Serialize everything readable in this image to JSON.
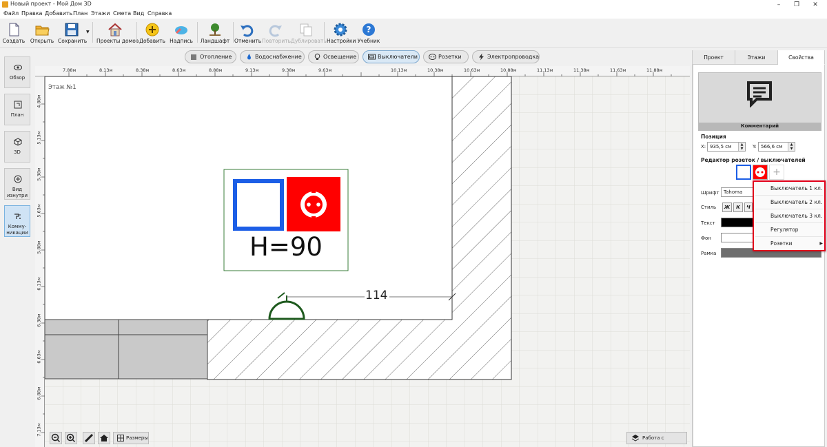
{
  "window": {
    "title": "Новый проект - Мой Дом 3D"
  },
  "menu": [
    "Файл",
    "Правка",
    "Добавить",
    "План",
    "Этажи",
    "Смета",
    "Вид",
    "Справка"
  ],
  "toolbar": {
    "create": "Создать",
    "open": "Открыть",
    "save": "Сохранить",
    "house_projects": "Проекты домов",
    "add": "Добавить",
    "caption": "Надпись",
    "landscape": "Ландшафт",
    "undo": "Отменить",
    "redo": "Повторить",
    "duplicate": "Дублировать",
    "settings": "Настройки",
    "tutorial": "Учебник"
  },
  "sidebar": {
    "overview": "Обзор",
    "plan": "План",
    "view3d": "3D",
    "inside_l1": "Вид",
    "inside_l2": "изнутри",
    "comm_l1": "Комму-",
    "comm_l2": "никации"
  },
  "categories": [
    "Отопление",
    "Водоснабжение",
    "Освещение",
    "Выключатели",
    "Розетки",
    "Электропроводка"
  ],
  "active_category": "Выключатели",
  "ruler": {
    "h": [
      "7.88м",
      "8.13м",
      "8.38м",
      "8.63м",
      "8.88м",
      "9.13м",
      "9.38м",
      "9.63м",
      "10.13м",
      "10.38м",
      "10.63м",
      "10.88м",
      "11.13м",
      "11.38м",
      "11.63м",
      "11.88м"
    ],
    "v": [
      "4.88м",
      "5.13м",
      "5.38м",
      "5.63м",
      "5.88м",
      "6.13м",
      "6.38м",
      "6.63м",
      "6.88м",
      "7.13м"
    ]
  },
  "canvas": {
    "floor_label": "Этаж №1",
    "marker_text": "H=90",
    "dimension": "114"
  },
  "canvas_controls": {
    "sizes": "Размеры",
    "floors": "Работа с этажами"
  },
  "panel": {
    "tabs": [
      "Проект",
      "Этажи",
      "Свойства"
    ],
    "preview_caption": "Комментарий",
    "position_title": "Позиция",
    "x_label": "X:",
    "x_value": "935,5 см",
    "y_label": "Y:",
    "y_value": "566,6 см",
    "editor_title": "Редактор розеток / выключателей",
    "font_label": "Шрифт",
    "font_value": "Tahoma",
    "style_label": "Стиль",
    "bold": "Ж",
    "italic": "К",
    "underline": "Ч",
    "text_label": "Текст",
    "bg_label": "Фон",
    "frame_label": "Рамка"
  },
  "dropdown": [
    "Выключатель 1 кл.",
    "Выключатель 2 кл.",
    "Выключатель 3 кл.",
    "Регулятор",
    "Розетки"
  ],
  "colors": {
    "highlight": "#e2001a",
    "accent_blue": "#1c5ee6",
    "socket_red": "#ff0000",
    "symbol_green": "#1e5a1e"
  }
}
